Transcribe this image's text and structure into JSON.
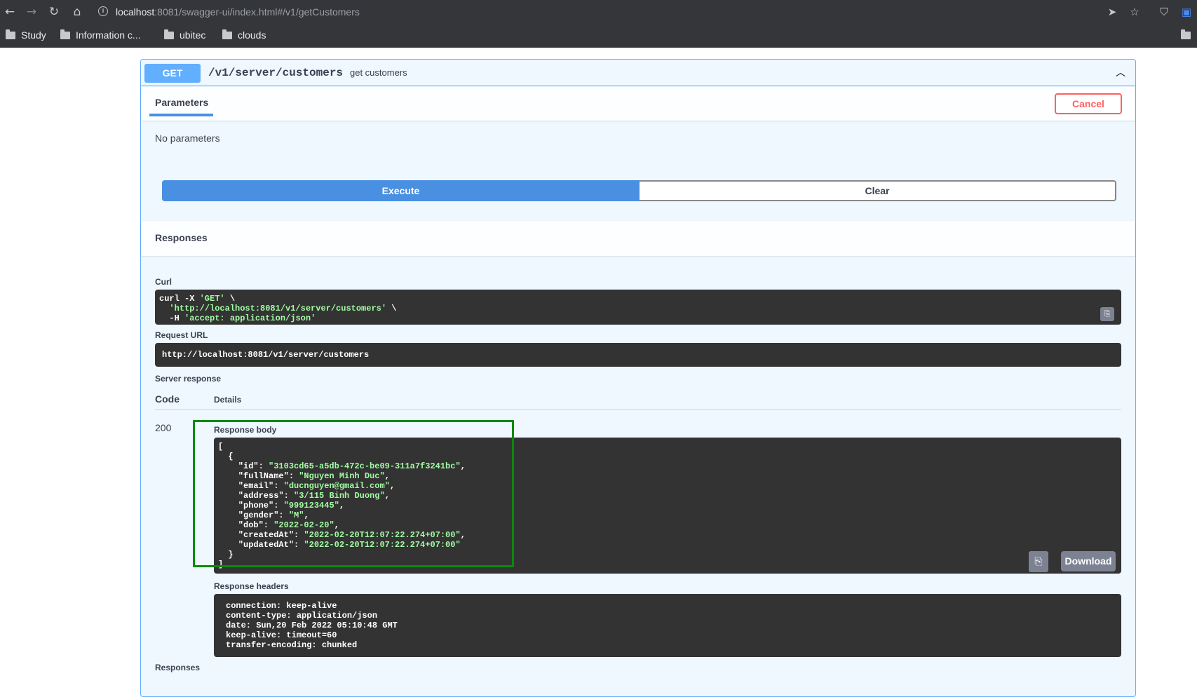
{
  "browser": {
    "url_host": "localhost",
    "url_rest": ":8081/swagger-ui/index.html#/v1/getCustomers",
    "bookmarks": [
      "Study",
      "Information c...",
      "ubitec",
      "clouds"
    ]
  },
  "operation": {
    "method": "GET",
    "path": "/v1/server/customers",
    "description": "get customers",
    "parameters_tab": "Parameters",
    "cancel_label": "Cancel",
    "no_params": "No parameters",
    "execute_label": "Execute",
    "clear_label": "Clear",
    "responses_heading": "Responses",
    "responses_footer": "Responses"
  },
  "result": {
    "curl_label": "Curl",
    "curl_lines": {
      "l1a": "curl -X ",
      "l1b": "'GET'",
      "l1c": " \\",
      "l2a": "  ",
      "l2b": "'http://localhost:8081/v1/server/customers'",
      "l2c": " \\",
      "l3a": "  -H ",
      "l3b": "'accept: application/json'"
    },
    "request_url_label": "Request URL",
    "request_url": "http://localhost:8081/v1/server/customers",
    "server_response_label": "Server response",
    "code_col": "Code",
    "details_col": "Details",
    "status_code": "200",
    "response_body_label": "Response body",
    "response_body": {
      "id": "3103cd65-a5db-472c-be09-311a7f3241bc",
      "fullName": "Nguyen Minh Duc",
      "email": "ducnguyen@gmail.com",
      "address": "3/115 Binh Duong",
      "phone": "999123445",
      "gender": "M",
      "dob": "2022-02-20",
      "createdAt": "2022-02-20T12:07:22.274+07:00",
      "updatedAt": "2022-02-20T12:07:22.274+07:00"
    },
    "download_label": "Download",
    "response_headers_label": "Response headers",
    "response_headers": [
      "connection: keep-alive",
      "content-type: application/json",
      "date: Sun,20 Feb 2022 05:10:48 GMT",
      "keep-alive: timeout=60",
      "transfer-encoding: chunked"
    ]
  },
  "colors": {
    "get_method": "#61affe",
    "execute": "#4990e2",
    "cancel": "#ff6060",
    "highlight_box": "#0a8a0a",
    "code_bg": "#333333",
    "string_value": "#a2fca2"
  }
}
